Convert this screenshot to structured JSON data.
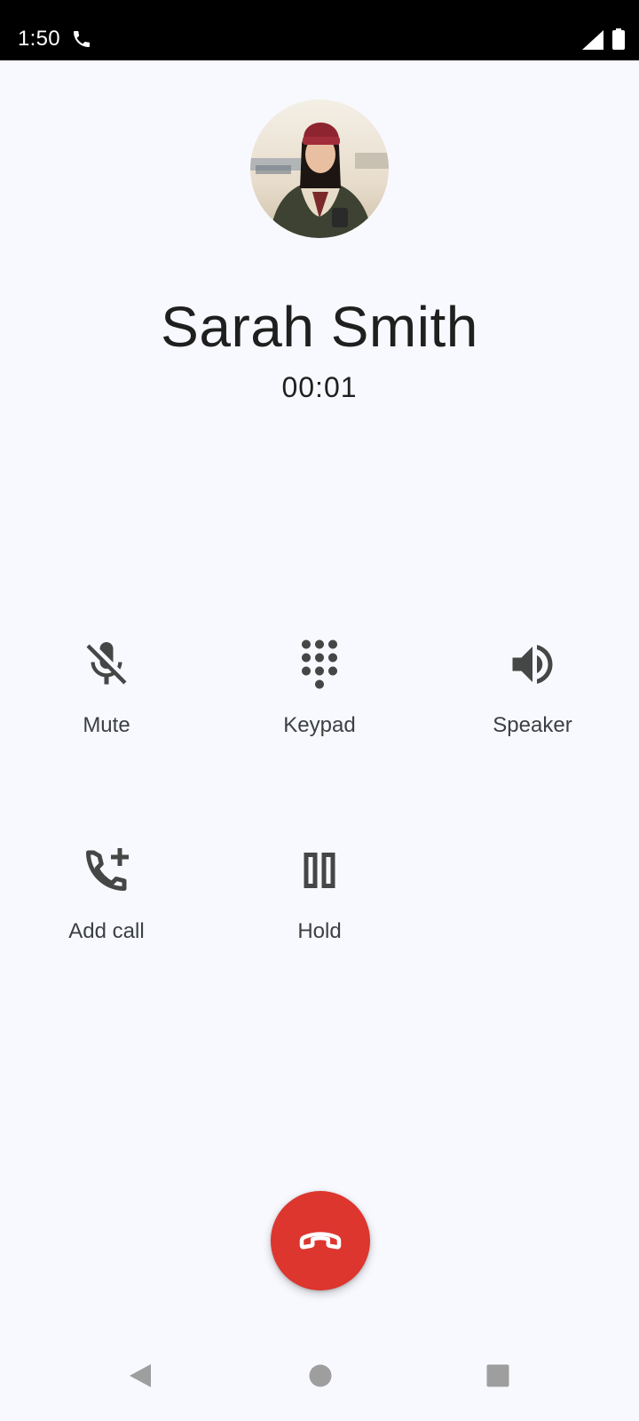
{
  "status_bar": {
    "time": "1:50",
    "icons": [
      "phone-call-icon",
      "cell-signal-icon",
      "battery-icon"
    ]
  },
  "contact": {
    "name": "Sarah Smith",
    "duration": "00:01"
  },
  "controls": {
    "mute": {
      "label": "Mute",
      "icon": "mic-off-icon"
    },
    "keypad": {
      "label": "Keypad",
      "icon": "dialpad-icon"
    },
    "speaker": {
      "label": "Speaker",
      "icon": "volume-up-icon"
    },
    "add_call": {
      "label": "Add call",
      "icon": "add-call-icon"
    },
    "hold": {
      "label": "Hold",
      "icon": "pause-icon"
    }
  },
  "end_call": {
    "icon": "call-end-icon"
  },
  "nav": {
    "back_icon": "back-icon",
    "home_icon": "home-icon",
    "recents_icon": "recents-icon"
  },
  "colors": {
    "background": "#f8f9fe",
    "icon": "#444746",
    "end_call": "#dc362e",
    "status_bar": "#000000"
  }
}
